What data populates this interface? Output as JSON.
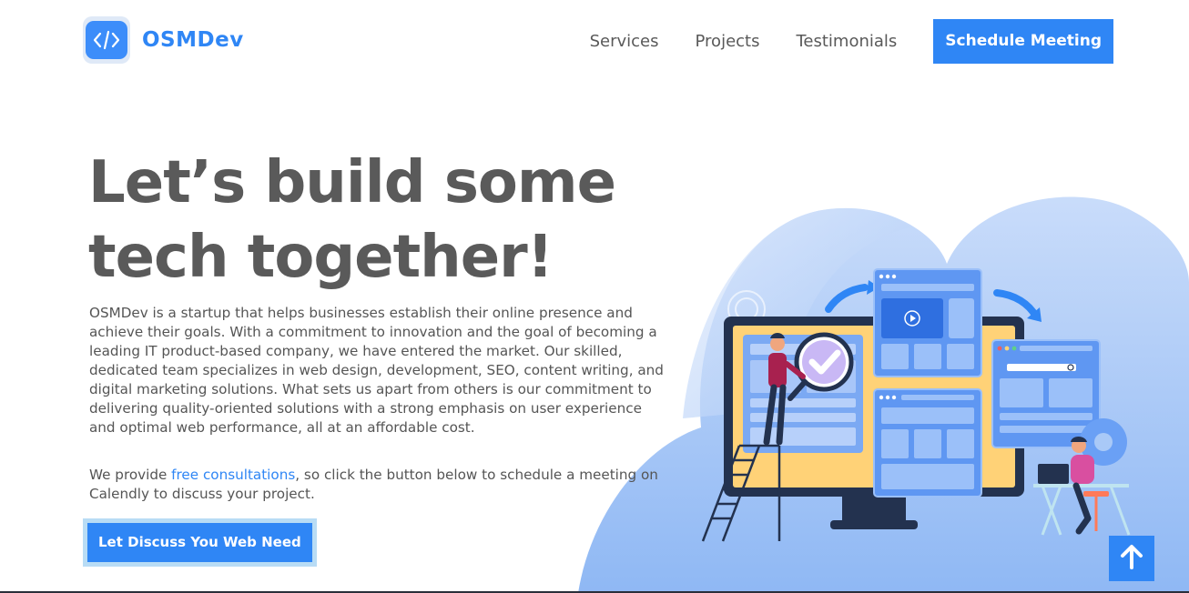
{
  "header": {
    "logo_text": "OSMDev",
    "logo_icon": "code-brackets-icon",
    "nav": {
      "services": "Services",
      "projects": "Projects",
      "testimonials": "Testimonials",
      "schedule_button": "Schedule Meeting"
    }
  },
  "hero": {
    "title_line1": "Let’s build some",
    "title_line2": "tech together!",
    "description": "OSMDev is a startup that helps businesses establish their online presence and achieve their goals. With a commitment to innovation and the goal of becoming a leading IT product-based company, we have entered the market. Our skilled, dedicated team specializes in web design, development, SEO, content writing, and digital marketing solutions. What sets us apart from others is our commitment to delivering quality-oriented solutions with a strong emphasis on user experience and optimal web performance, all at an affordable cost.",
    "consult_prefix": "We provide ",
    "consult_link": "free consultations",
    "consult_suffix": ", so click the button below to schedule a meeting on Calendly to discuss your project.",
    "cta_button": "Let Discuss You Web Need"
  },
  "illustration": {
    "icon": "web-development-illustration"
  },
  "scroll_top": {
    "icon": "arrow-up-icon"
  },
  "colors": {
    "accent": "#2f86f5",
    "heading": "#5a5a5a",
    "body_text": "#555555",
    "cloud": "#a9c9f7",
    "cta_outline": "#b8dcf5"
  }
}
